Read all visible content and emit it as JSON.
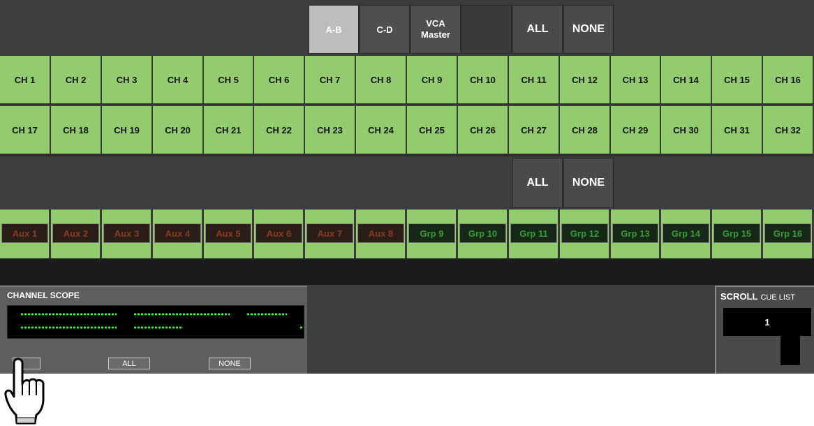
{
  "header": {
    "ab": "A-B",
    "cd": "C-D",
    "vca_line1": "VCA",
    "vca_line2": "Master",
    "all": "ALL",
    "none": "NONE"
  },
  "channels_row1": [
    "CH 1",
    "CH 2",
    "CH 3",
    "CH 4",
    "CH 5",
    "CH 6",
    "CH 7",
    "CH 8",
    "CH 9",
    "CH 10",
    "CH 11",
    "CH 12",
    "CH 13",
    "CH 14",
    "CH 15",
    "CH 16"
  ],
  "channels_row2": [
    "CH 17",
    "CH 18",
    "CH 19",
    "CH 20",
    "CH 21",
    "CH 22",
    "CH 23",
    "CH 24",
    "CH 25",
    "CH 26",
    "CH 27",
    "CH 28",
    "CH 29",
    "CH 30",
    "CH 31",
    "CH 32"
  ],
  "mid": {
    "all": "ALL",
    "none": "NONE"
  },
  "buses": [
    "Aux 1",
    "Aux 2",
    "Aux 3",
    "Aux 4",
    "Aux 5",
    "Aux 6",
    "Aux 7",
    "Aux 8",
    "Grp 9",
    "Grp 10",
    "Grp 11",
    "Grp 12",
    "Grp 13",
    "Grp 14",
    "Grp 15",
    "Grp 16"
  ],
  "scope": {
    "title": "CHANNEL SCOPE",
    "all": "ALL",
    "none": "NONE"
  },
  "scroll": {
    "title_bold": "SCROLL",
    "title_small": "CUE LIST",
    "cue": "1"
  },
  "colors": {
    "channel_green": "#92cc6f",
    "aux_text": "#8a3a1c",
    "grp_text": "#2f9e2f",
    "led": "#33ff33"
  },
  "icons": {
    "cursor": "hand-pointer-icon"
  }
}
